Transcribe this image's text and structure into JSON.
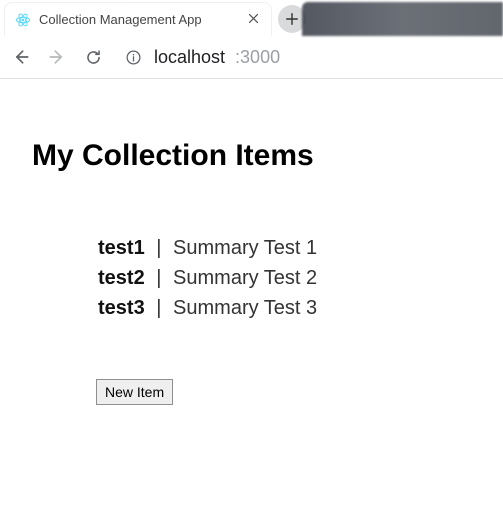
{
  "browser": {
    "tab_title": "Collection Management App",
    "url_host": "localhost",
    "url_port": ":3000"
  },
  "page": {
    "heading": "My Collection Items",
    "items": [
      {
        "name": "test1",
        "summary": "Summary Test 1"
      },
      {
        "name": "test2",
        "summary": "Summary Test 2"
      },
      {
        "name": "test3",
        "summary": "Summary Test 3"
      }
    ],
    "separator": "|",
    "new_item_label": "New Item"
  }
}
